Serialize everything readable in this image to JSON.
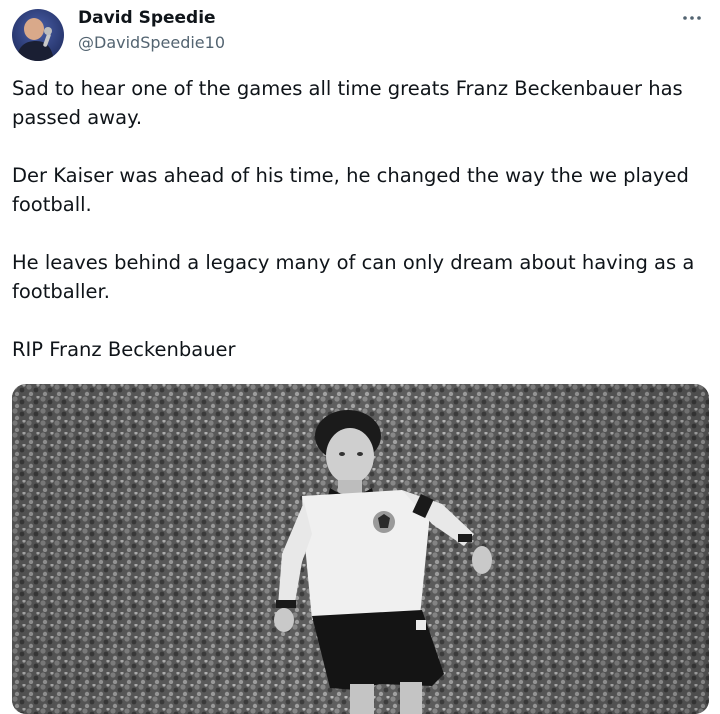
{
  "tweet": {
    "author": {
      "display_name": "David Speedie",
      "handle": "@DavidSpeedie10"
    },
    "more_label": "···",
    "paragraphs": [
      "Sad to hear one of the games all time greats Franz Beckenbauer has passed away.",
      "Der Kaiser was ahead of his time, he changed the way the we played football.",
      "He leaves behind a legacy many of can only dream about having as a footballer.",
      "RIP Franz Beckenbauer"
    ]
  },
  "colors": {
    "text_primary": "#0f1419",
    "text_secondary": "#536471",
    "background": "#ffffff"
  },
  "icons": {
    "more": "more-horizontal-icon"
  }
}
